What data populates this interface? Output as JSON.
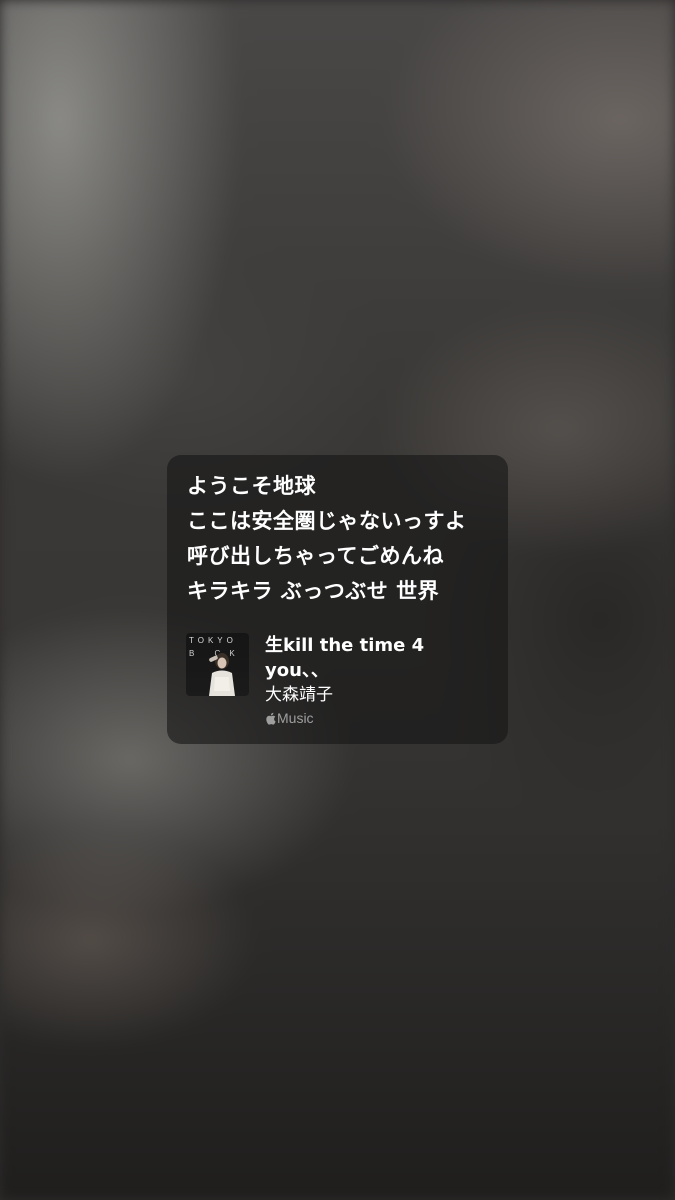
{
  "lyrics_card": {
    "lines": [
      "ようこそ地球",
      "ここは安全圏じゃないっすよ",
      "呼び出しちゃってごめんね",
      "キラキラ ぶっつぶせ 世界"
    ],
    "album_art": {
      "text_row1": "TOKYO",
      "text_row2": "B CK"
    },
    "track": {
      "title": "生kill the time 4 you、、",
      "artist": "大森靖子"
    },
    "source": {
      "icon": "apple-logo-icon",
      "label": "Music"
    }
  }
}
